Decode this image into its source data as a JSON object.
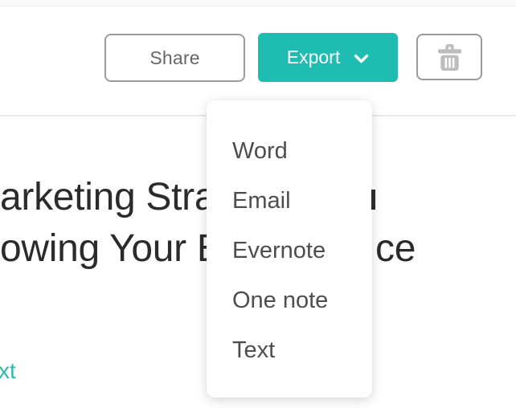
{
  "colors": {
    "accent_teal": "#1fbdb1",
    "link_teal": "#29bbad",
    "button_border_gray": "#9b9b9b",
    "trash_icon_gray": "#bdbdbd",
    "heading_text": "#2b2b2b",
    "menu_text": "#4d4d4d",
    "divider": "#e9e9e9"
  },
  "toolbar": {
    "share_label": "Share",
    "export_label": "Export",
    "icons": {
      "export_chevron": "chevron-down",
      "delete": "trash"
    }
  },
  "export_menu": {
    "items": [
      "Word",
      "Email",
      "Evernote",
      "One note",
      "Text"
    ]
  },
  "document": {
    "heading_visible_line1": "arketing Stra",
    "heading_visible_line2": "owing Your E",
    "heading_cropped_fragment_line1": "l",
    "heading_cropped_fragment_line2": "ce",
    "cropped_link_text": "xt"
  }
}
